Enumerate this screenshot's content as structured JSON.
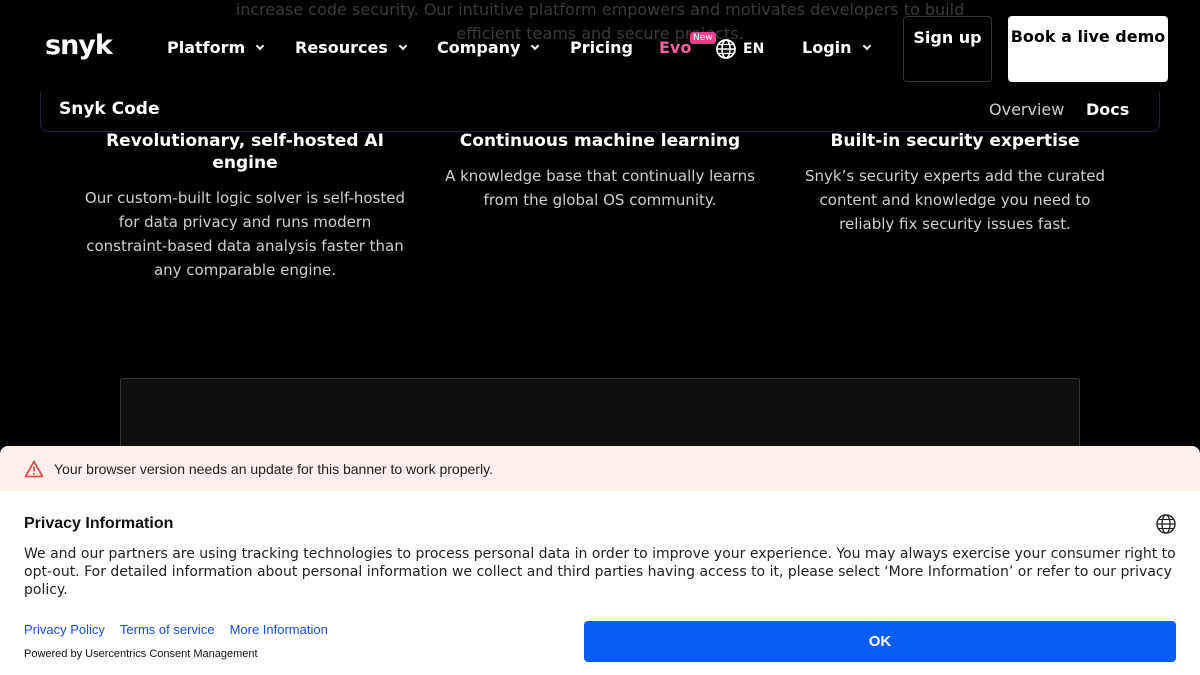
{
  "background_text": {
    "line1": "increase code security. Our intuitive platform empowers and motivates developers to build",
    "line2": "efficient teams and secure projects."
  },
  "nav": {
    "logo": "snyk",
    "platform": "Platform",
    "resources": "Resources",
    "company": "Company",
    "pricing": "Pricing",
    "evo": "Evo",
    "evo_badge": "New",
    "lang": "EN",
    "login": "Login",
    "signup": "Sign up",
    "demo": "Book a live demo"
  },
  "subnav": {
    "title": "Snyk Code",
    "overview": "Overview",
    "docs": "Docs"
  },
  "features": [
    {
      "title": "Revolutionary, self-hosted AI engine",
      "body": "Our custom-built logic solver is self-hosted for data privacy and runs modern constraint-based data analysis faster than any comparable engine."
    },
    {
      "title": "Continuous machine learning",
      "body": "A knowledge base that continually learns from the global OS community."
    },
    {
      "title": "Built-in security expertise",
      "body": "Snyk’s security experts add the curated content and knowledge you need to reliably fix security issues fast."
    }
  ],
  "warning": {
    "text": "Your browser version needs an update for this banner to work properly."
  },
  "consent": {
    "title": "Privacy Information",
    "body": "We and our partners are using tracking technologies to process personal data in order to improve your experience. You may always exercise your consumer right to opt-out. For detailed information about personal information we collect and third parties having access to it, please select ‘More Information’ or refer to our privacy policy.",
    "link_privacy": "Privacy Policy",
    "link_terms": "Terms of service",
    "link_more": "More Information",
    "powered": "Powered by Usercentrics Consent Management",
    "ok": "OK"
  },
  "colors": {
    "accent_evo": "#ff5fa2",
    "ok_button": "#0a5df5",
    "warning_bg": "#fdf0ea"
  }
}
